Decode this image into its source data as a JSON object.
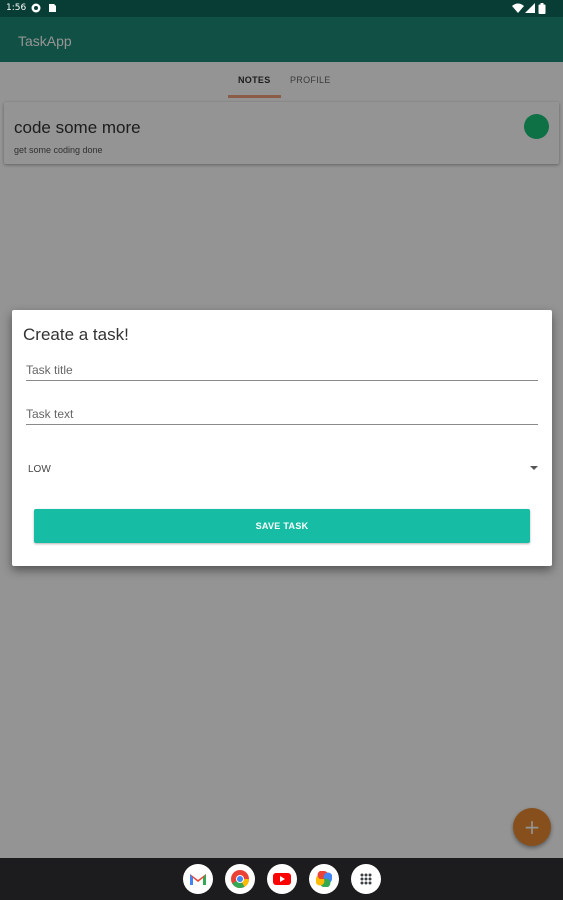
{
  "status_bar": {
    "time": "1:56"
  },
  "app": {
    "title": "TaskApp"
  },
  "tabs": [
    {
      "label": "NOTES",
      "selected": true
    },
    {
      "label": "PROFILE",
      "selected": false
    }
  ],
  "notes": [
    {
      "title": "code some more",
      "text": "get some coding done",
      "priority_color": "#19c277"
    }
  ],
  "dialog": {
    "title": "Create a task!",
    "task_title_placeholder": "Task title",
    "task_text_placeholder": "Task text",
    "priority_selected": "LOW",
    "save_label": "SAVE TASK"
  },
  "fab": {
    "icon": "plus-icon"
  },
  "dock": [
    "gmail-icon",
    "chrome-icon",
    "youtube-icon",
    "photos-icon",
    "app-drawer-icon"
  ],
  "colors": {
    "app_bar": "#1e8a77",
    "status_bar": "#073d35",
    "accent_button": "#17bca5",
    "fab": "#e8892f",
    "tab_indicator": "#f0a07d",
    "priority_low": "#19c277"
  }
}
